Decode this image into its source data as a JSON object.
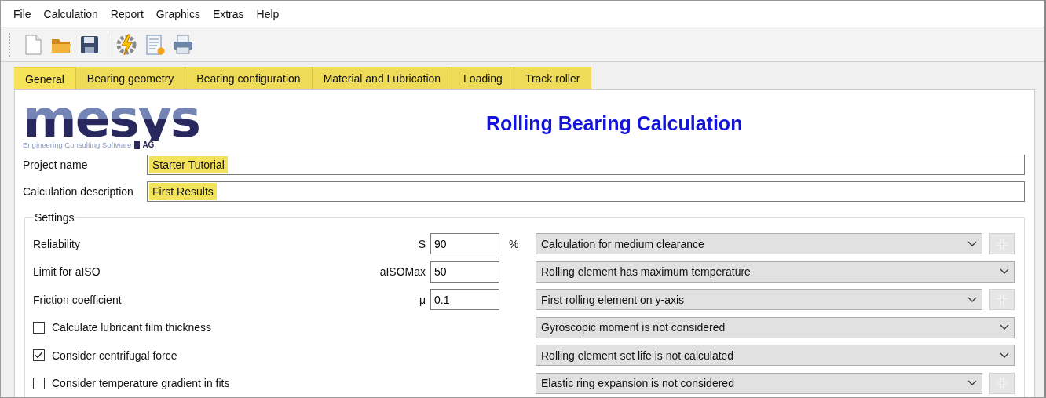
{
  "menu": [
    "File",
    "Calculation",
    "Report",
    "Graphics",
    "Extras",
    "Help"
  ],
  "toolbar": [
    {
      "kind": "new"
    },
    {
      "kind": "open"
    },
    {
      "kind": "save"
    },
    {
      "kind": "separator"
    },
    {
      "kind": "calculate"
    },
    {
      "kind": "report"
    },
    {
      "kind": "print"
    }
  ],
  "tabs": [
    {
      "label": "General",
      "selected": true
    },
    {
      "label": "Bearing geometry",
      "selected": false
    },
    {
      "label": "Bearing configuration",
      "selected": false
    },
    {
      "label": "Material and Lubrication",
      "selected": false
    },
    {
      "label": "Loading",
      "selected": false
    },
    {
      "label": "Track roller",
      "selected": false
    }
  ],
  "logo": {
    "word": "mesys",
    "tagline": "Engineering Consulting Software",
    "suffix": "AG"
  },
  "heading": "Rolling Bearing Calculation",
  "fields": [
    {
      "label": "Project name",
      "value": "Starter Tutorial",
      "highlighted": true
    },
    {
      "label": "Calculation description",
      "value": "First Results",
      "highlighted": true
    }
  ],
  "settings": {
    "title": "Settings",
    "rows": [
      {
        "kind": "value",
        "label": "Reliability",
        "symbol": "S",
        "value": "90",
        "unit": "%",
        "select": "Calculation for medium clearance",
        "add_button": true
      },
      {
        "kind": "value",
        "label": "Limit for aISO",
        "symbol": "aISOMax",
        "value": "50",
        "select": "Rolling element has maximum temperature",
        "add_button": false
      },
      {
        "kind": "value",
        "label": "Friction coefficient",
        "symbol": "μ",
        "value": "0.1",
        "select": "First rolling element on y-axis",
        "add_button": true
      },
      {
        "kind": "checkbox",
        "label": "Calculate lubricant film thickness",
        "checked": false,
        "select": "Gyroscopic moment is not considered",
        "add_button": false
      },
      {
        "kind": "checkbox",
        "label": "Consider centrifugal force",
        "checked": true,
        "select": "Rolling element set life is not calculated",
        "add_button": false
      },
      {
        "kind": "checkbox",
        "label": "Consider temperature gradient in fits",
        "checked": false,
        "select": "Elastic ring expansion is not considered",
        "add_button": true
      }
    ]
  }
}
